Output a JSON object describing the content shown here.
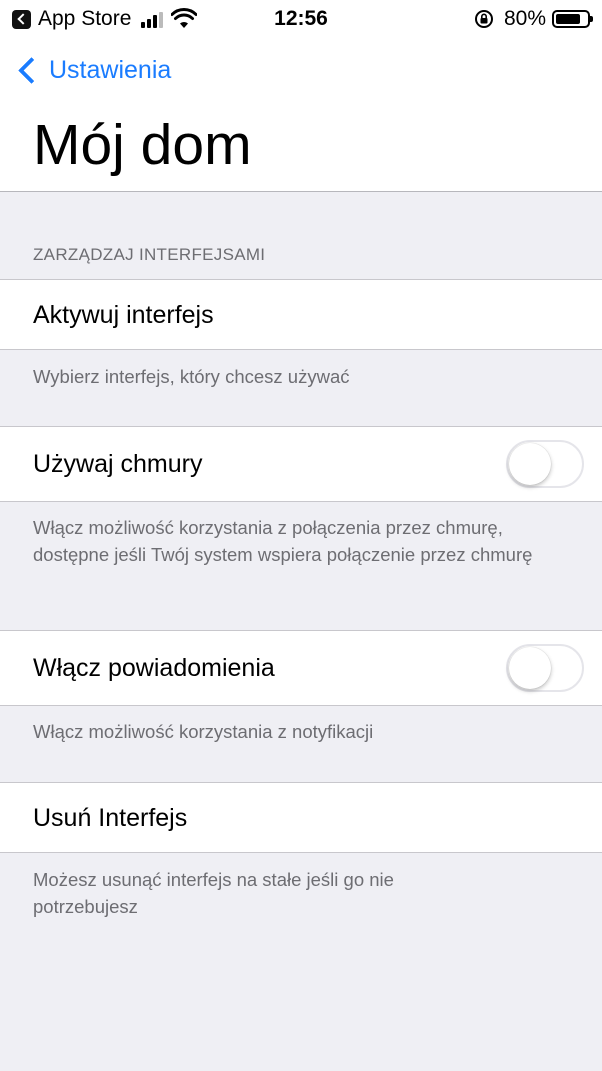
{
  "status_bar": {
    "app": "App Store",
    "time": "12:56",
    "battery": "80%",
    "battery_level": 0.8
  },
  "nav": {
    "back_label": "Ustawienia",
    "title": "Mój dom"
  },
  "section": {
    "header": "ZARZĄDZAJ INTERFEJSAMI"
  },
  "rows": {
    "activate": {
      "label": "Aktywuj interfejs",
      "footer": "Wybierz interfejs, który chcesz używać"
    },
    "cloud": {
      "label": "Używaj chmury",
      "enabled": false,
      "footer": "Włącz możliwość korzystania z połączenia przez chmurę, dostępne jeśli Twój system wspiera połączenie przez chmurę"
    },
    "notifications": {
      "label": "Włącz powiadomienia",
      "enabled": false,
      "footer": "Włącz możliwość korzystania z notyfikacji"
    },
    "remove": {
      "label": "Usuń Interfejs",
      "footer": "Możesz usunąć interfejs na stałe jeśli go nie potrzebujesz"
    }
  },
  "colors": {
    "accent": "#1a7cff",
    "background": "#efeff4",
    "secondary_text": "#6d6d72"
  }
}
